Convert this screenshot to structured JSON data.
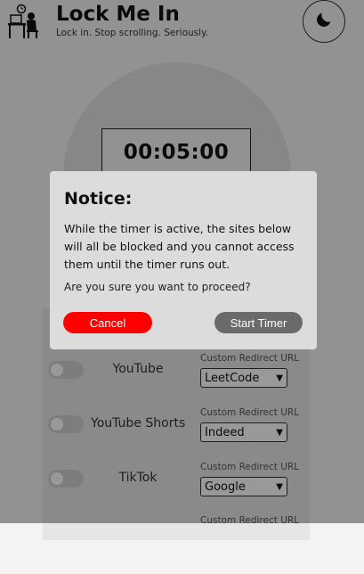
{
  "app": {
    "title": "Lock Me In",
    "subtitle": "Lock in. Stop scrolling. Seriously.",
    "logo_icon": "person-at-desk-icon",
    "theme_icon": "moon-icon"
  },
  "timer": {
    "value": "00:05:00"
  },
  "sites": [
    {
      "name": "YouTube",
      "enabled": false,
      "redirect_label": "Custom Redirect URL",
      "redirect_value": "LeetCode"
    },
    {
      "name": "YouTube Shorts",
      "enabled": false,
      "redirect_label": "Custom Redirect URL",
      "redirect_value": "Indeed"
    },
    {
      "name": "TikTok",
      "enabled": false,
      "redirect_label": "Custom Redirect URL",
      "redirect_value": "Google"
    },
    {
      "redirect_label": "Custom Redirect URL"
    }
  ],
  "modal": {
    "title": "Notice:",
    "body": "While the timer is active, the sites below will all be blocked and you cannot access them until the timer runs out.",
    "confirm": "Are you sure you want to proceed?",
    "cancel_label": "Cancel",
    "start_label": "Start Timer"
  },
  "colors": {
    "cancel": "#ff0000",
    "start": "#6a6a6a",
    "overlay": "rgba(0,0,0,0.4)"
  }
}
